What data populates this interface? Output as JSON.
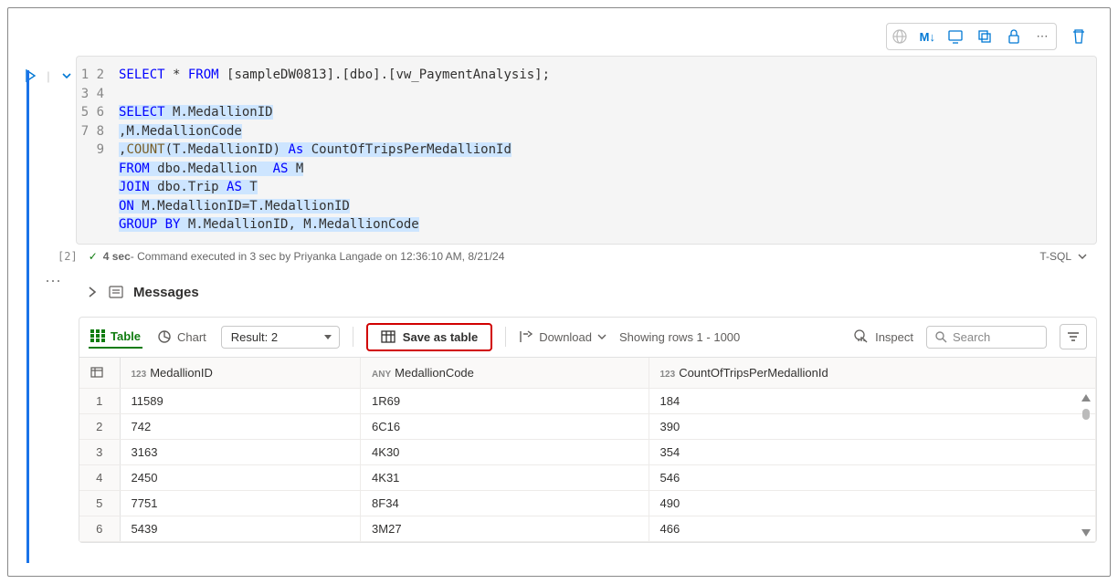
{
  "toolbar_icons": {
    "md": "M↓"
  },
  "code": {
    "lines": [
      "1",
      "2",
      "3",
      "4",
      "5",
      "6",
      "7",
      "8",
      "9"
    ],
    "l1": {
      "a": "SELECT",
      "b": " * ",
      "c": "FROM",
      "d": " [sampleDW0813].[dbo].[vw_PaymentAnalysis];"
    },
    "l3": {
      "a": "SELECT",
      "b": " M.MedallionID"
    },
    "l4": {
      "a": ",M.MedallionCode"
    },
    "l5": {
      "a": ",",
      "b": "COUNT",
      "c": "(T.MedallionID) ",
      "d": "As",
      "e": " CountOfTripsPerMedallionId"
    },
    "l6": {
      "a": "FROM",
      "b": " dbo.Medallion  ",
      "c": "AS",
      "d": " M"
    },
    "l7": {
      "a": "JOIN",
      "b": " dbo.Trip ",
      "c": "AS",
      "d": " T"
    },
    "l8": {
      "a": "ON",
      "b": " M.MedallionID=T.MedallionID"
    },
    "l9": {
      "a": "GROUP BY",
      "b": " M.MedallionID, M.MedallionCode"
    }
  },
  "status": {
    "exec_index": "[2]",
    "duration": "4 sec",
    "detail": " - Command executed in 3 sec by Priyanka Langade on 12:36:10 AM, 8/21/24",
    "lang": "T-SQL"
  },
  "messages_label": "Messages",
  "tabs": {
    "table": "Table",
    "chart": "Chart"
  },
  "result_selector": "Result: 2",
  "save_as_table": "Save as table",
  "download": "Download",
  "rows_info": "Showing rows 1 - 1000",
  "inspect": "Inspect",
  "search_placeholder": "Search",
  "columns": [
    {
      "type": "123",
      "name": "MedallionID"
    },
    {
      "type": "ANY",
      "name": "MedallionCode"
    },
    {
      "type": "123",
      "name": "CountOfTripsPerMedallionId"
    }
  ],
  "rows": [
    {
      "n": "1",
      "c": [
        "11589",
        "1R69",
        "184"
      ]
    },
    {
      "n": "2",
      "c": [
        "742",
        "6C16",
        "390"
      ]
    },
    {
      "n": "3",
      "c": [
        "3163",
        "4K30",
        "354"
      ]
    },
    {
      "n": "4",
      "c": [
        "2450",
        "4K31",
        "546"
      ]
    },
    {
      "n": "5",
      "c": [
        "7751",
        "8F34",
        "490"
      ]
    },
    {
      "n": "6",
      "c": [
        "5439",
        "3M27",
        "466"
      ]
    }
  ]
}
